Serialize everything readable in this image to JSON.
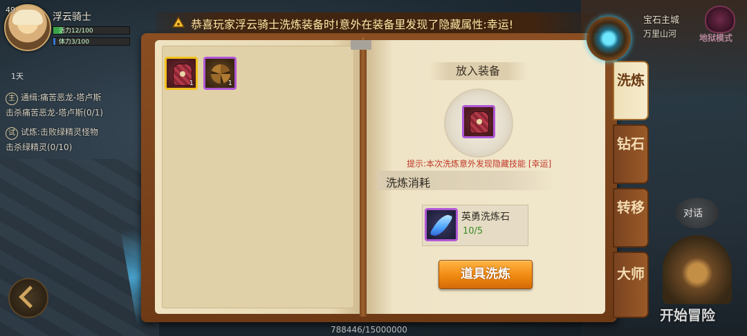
{
  "player": {
    "level": "49",
    "name": "浮云骑士",
    "stamina_label": "活力12/100",
    "energy_label": "体力3/100",
    "days": "1天"
  },
  "quests": [
    {
      "tag": "主",
      "title": "通缉:痛苦恶龙-塔卢斯",
      "detail": "击杀痛苦恶龙-塔卢斯(0/1)"
    },
    {
      "tag": "试",
      "title": "试炼:击败绿精灵怪物",
      "detail": "击杀绿精灵(0/10)"
    }
  ],
  "announcement": "恭喜玩家浮云骑士洗炼装备时!意外在装备里发现了隐藏属性:幸运!",
  "location": {
    "line1": "宝石主城",
    "line2": "万里山河"
  },
  "hell_mode": {
    "label": "地狱模式"
  },
  "inventory": [
    {
      "name": "red-armor",
      "count": "1",
      "rarity": "gold"
    },
    {
      "name": "claw-item",
      "count": "1",
      "rarity": "purple"
    }
  ],
  "refine": {
    "place_label": "放入装备",
    "hint": "提示:本次洗炼意外发现隐藏技能 [幸运]",
    "cost_label": "洗炼消耗",
    "material_name": "英勇洗炼石",
    "material_count": "10/5",
    "button_label": "道具洗炼"
  },
  "tabs": [
    {
      "label": "洗炼",
      "active": true
    },
    {
      "label": "钻石",
      "active": false
    },
    {
      "label": "转移",
      "active": false
    },
    {
      "label": "大师",
      "active": false
    }
  ],
  "exp": "788446/15000000",
  "talk_label": "对话",
  "adventure_label": "开始冒险",
  "colors": {
    "accent_orange": "#f08a12",
    "rarity_gold": "#f1c21b",
    "rarity_purple": "#b057d6",
    "hint_red": "#c0392b",
    "count_green": "#3b8a24"
  }
}
